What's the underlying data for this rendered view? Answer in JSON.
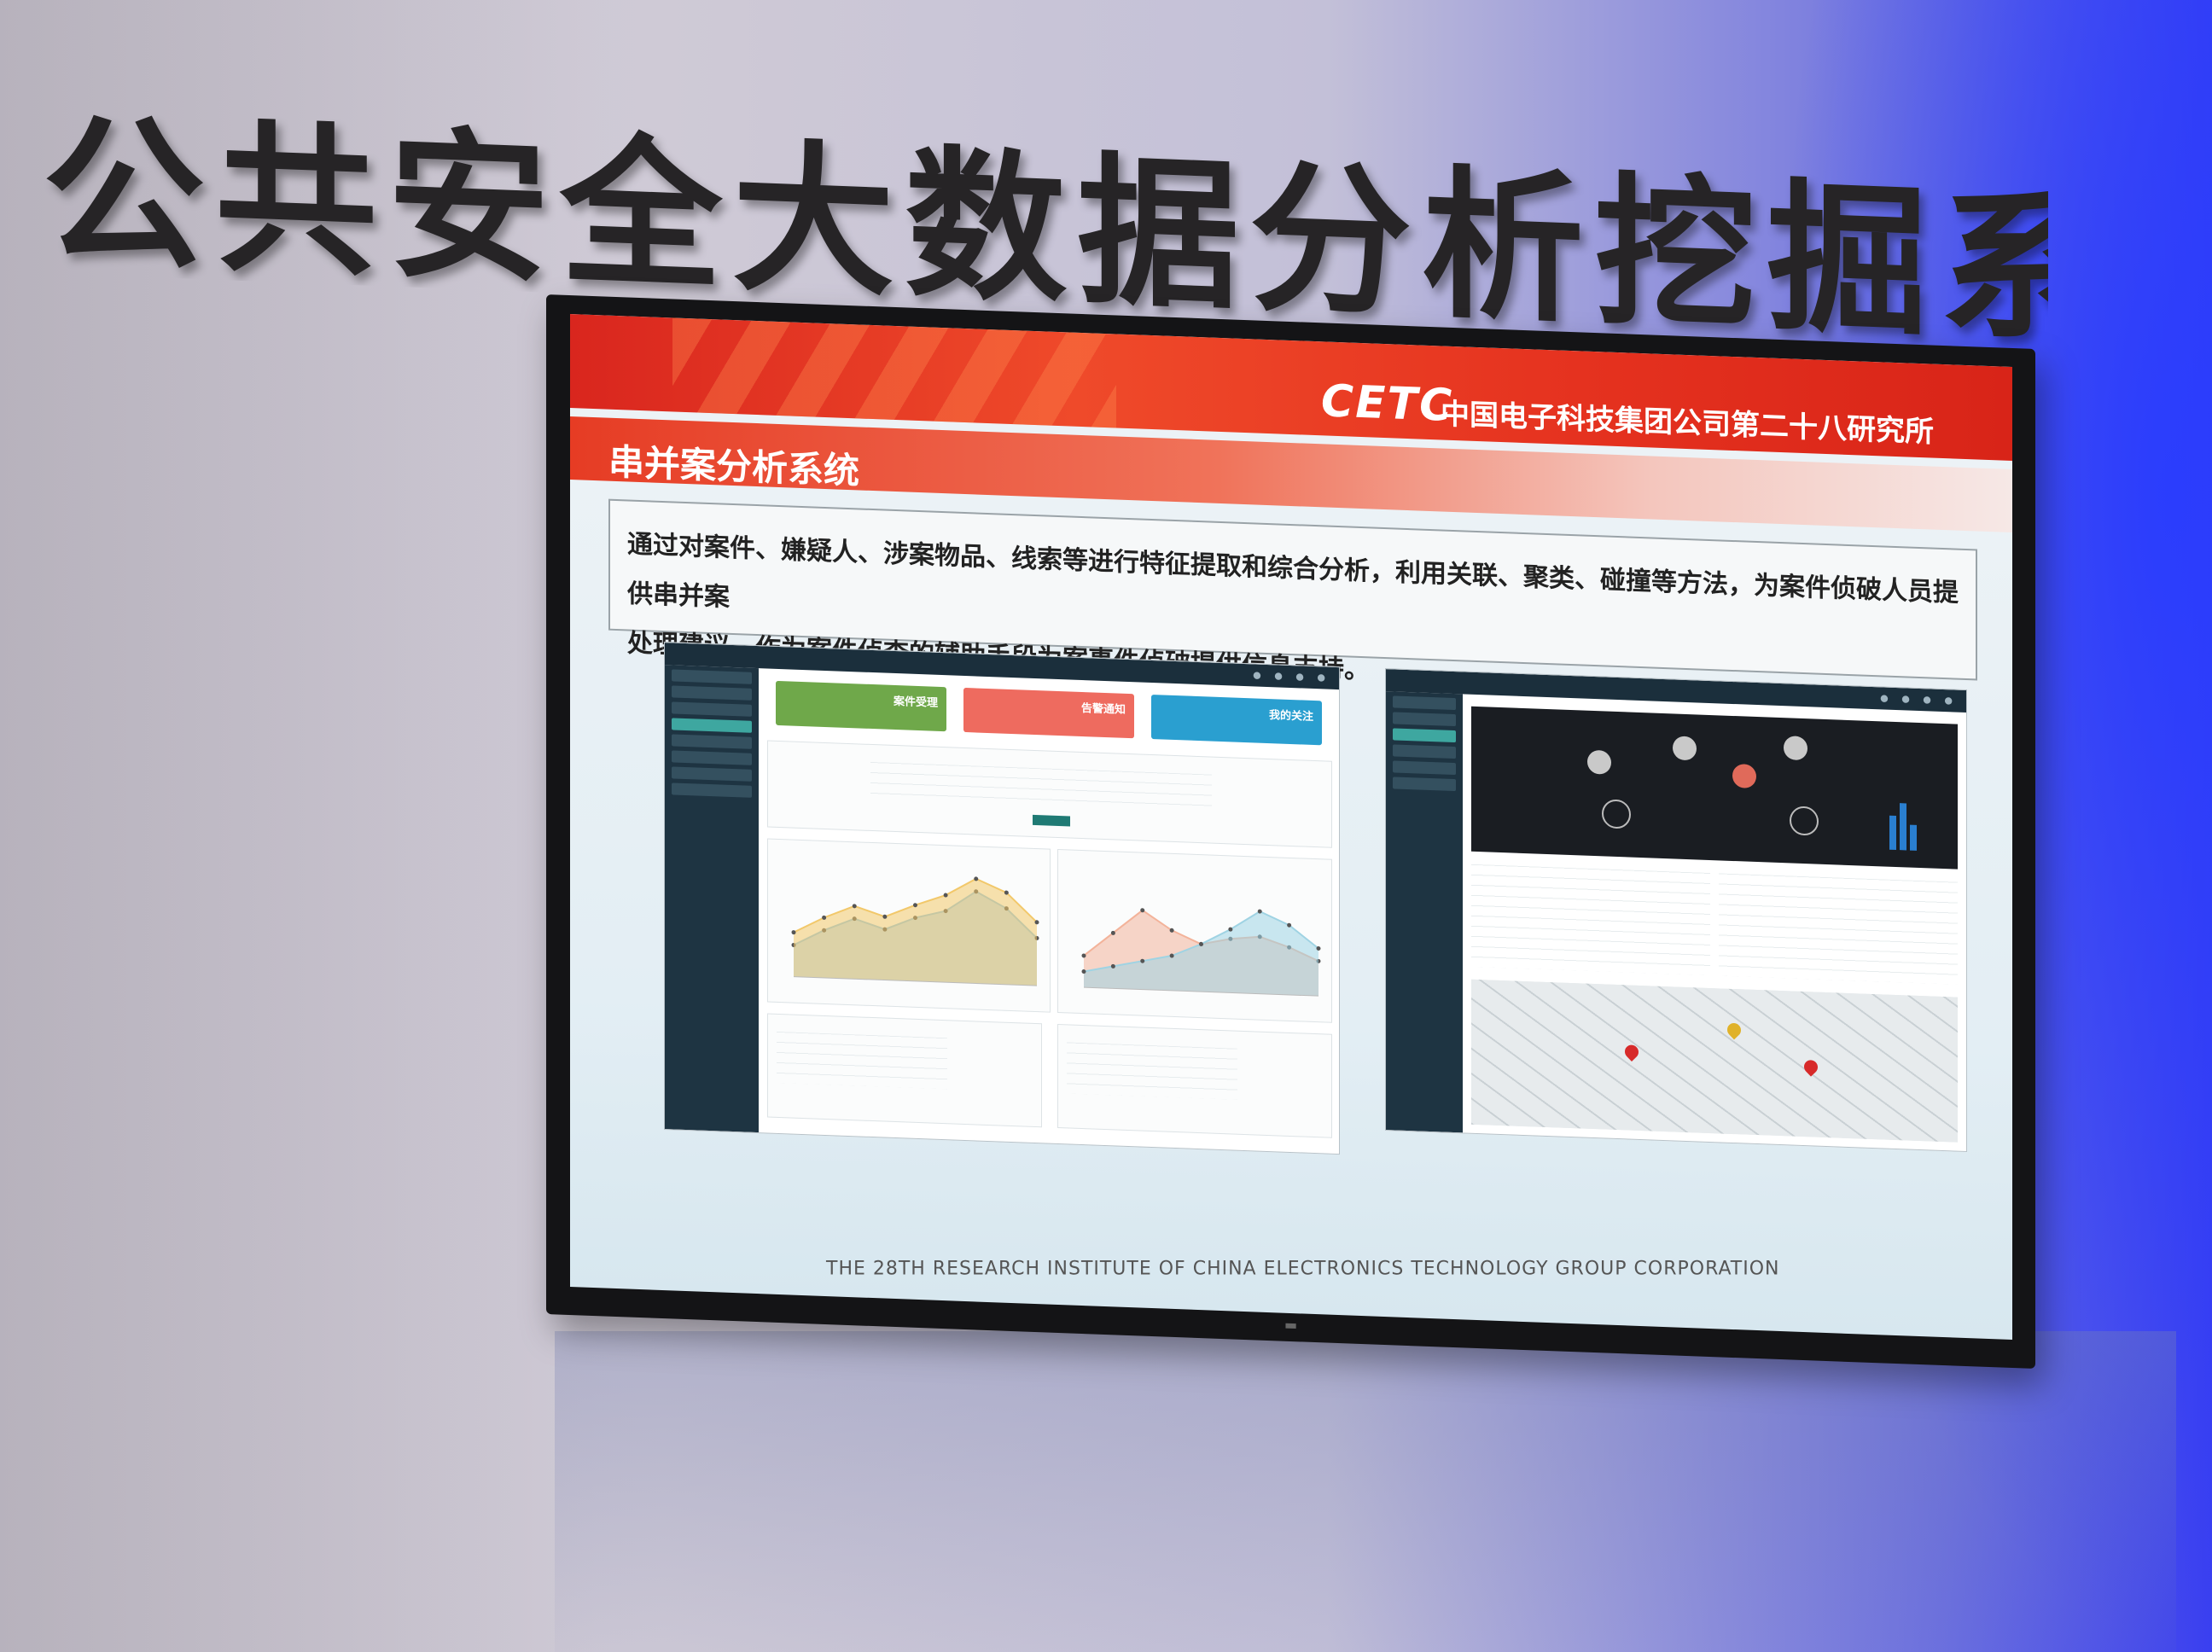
{
  "wall": {
    "title": "公共安全大数据分析挖掘系统"
  },
  "screen": {
    "logo": "CETC",
    "org_name_cn": "中国电子科技集团公司第二十八研究所",
    "section_title": "串并案分析系统",
    "description_line1": "通过对案件、嫌疑人、涉案物品、线索等进行特征提取和综合分析，利用关联、聚类、碰撞等方法，为案件侦破人员提供串并案",
    "description_line2": "处理建议，作为案件侦查的辅助手段为案事件侦破提供信息支持。",
    "footer_en": "THE 28TH RESEARCH INSTITUTE OF CHINA ELECTRONICS TECHNOLOGY GROUP CORPORATION",
    "screenshot1": {
      "tiles": [
        "案件受理",
        "告警通知",
        "我的关注"
      ],
      "tile_colors": [
        "#6fa84a",
        "#ee6b5f",
        "#2a9fd0"
      ]
    }
  },
  "chart_data": [
    {
      "type": "area",
      "x": [
        1,
        2,
        3,
        4,
        5,
        6,
        7,
        8,
        9
      ],
      "series": [
        {
          "values": [
            20,
            30,
            38,
            32,
            40,
            45,
            58,
            48,
            30
          ]
        },
        {
          "values": [
            28,
            38,
            46,
            40,
            48,
            55,
            66,
            58,
            40
          ]
        }
      ]
    },
    {
      "type": "area",
      "x": [
        1,
        2,
        3,
        4,
        5,
        6,
        7,
        8,
        9
      ],
      "series": [
        {
          "values": [
            20,
            35,
            50,
            38,
            30,
            34,
            36,
            30,
            22
          ]
        },
        {
          "values": [
            10,
            14,
            18,
            22,
            30,
            40,
            52,
            44,
            30
          ]
        }
      ]
    }
  ]
}
